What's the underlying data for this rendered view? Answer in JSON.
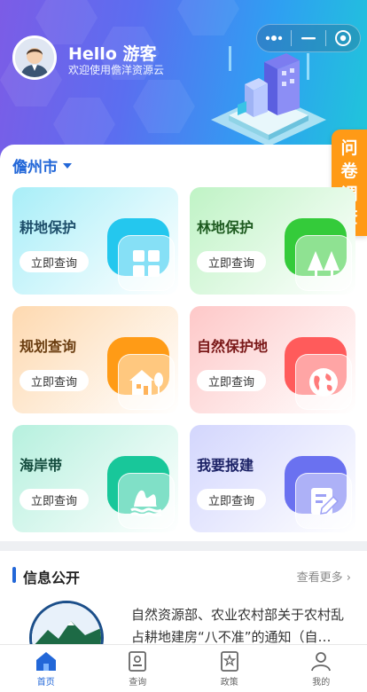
{
  "header": {
    "greeting": "Hello 游客",
    "subtitle": "欢迎使用儋洋资源云",
    "capsule": {
      "more_icon": "more-dots-icon",
      "min_icon": "minimize-icon",
      "close_icon": "target-close-icon"
    }
  },
  "location": {
    "city": "儋州市"
  },
  "survey": {
    "chars": [
      "问",
      "卷",
      "调",
      "查"
    ]
  },
  "cards": [
    {
      "title": "耕地保护",
      "button": "立即查询",
      "icon": "farmland-grid-icon",
      "title_color": "#1d4e6a",
      "bg": "#a8eef8",
      "blob": "#24c7ee"
    },
    {
      "title": "林地保护",
      "button": "立即查询",
      "icon": "forest-trees-icon",
      "title_color": "#1d5a1f",
      "bg": "#bff3c5",
      "blob": "#34cb3a"
    },
    {
      "title": "规划查询",
      "button": "立即查询",
      "icon": "house-tree-icon",
      "title_color": "#6a3d10",
      "bg": "#fed9b0",
      "blob": "#ff9b16"
    },
    {
      "title": "自然保护地",
      "button": "立即查询",
      "icon": "globe-icon",
      "title_color": "#7a1818",
      "bg": "#fec8c8",
      "blob": "#ff5b5b"
    },
    {
      "title": "海岸带",
      "button": "立即查询",
      "icon": "coast-waves-icon",
      "title_color": "#124a3c",
      "bg": "#b6f0de",
      "blob": "#18c79a"
    },
    {
      "title": "我要报建",
      "button": "立即查询",
      "icon": "edit-document-icon",
      "title_color": "#1c2266",
      "bg": "#d3d6fd",
      "blob": "#6a71f0"
    }
  ],
  "news": {
    "section_title": "信息公开",
    "more": "查看更多",
    "item_text": "自然资源部、农业农村部关于农村乱占耕地建房“八不准”的通知（自…"
  },
  "tabbar": [
    {
      "label": "首页",
      "icon": "home-icon",
      "active": true
    },
    {
      "label": "查询",
      "icon": "query-card-icon",
      "active": false
    },
    {
      "label": "政策",
      "icon": "policy-star-icon",
      "active": false
    },
    {
      "label": "我的",
      "icon": "user-icon",
      "active": false
    }
  ],
  "colors": {
    "accent": "#2267d8",
    "survey": "#ff9a16"
  }
}
